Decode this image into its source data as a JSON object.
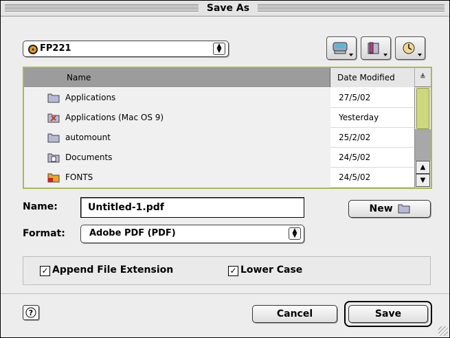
{
  "window": {
    "title": "Save As"
  },
  "location": {
    "selected": "FP221"
  },
  "toolbar": {
    "icons": [
      "shortcuts-icon",
      "favorites-icon",
      "recent-icon"
    ]
  },
  "filelist": {
    "columns": {
      "name": "Name",
      "date": "Date Modified",
      "sort": "≜"
    },
    "rows": [
      {
        "name": "Applications",
        "date": "27/5/02",
        "icon": "folder-icon"
      },
      {
        "name": "Applications (Mac OS 9)",
        "date": "Yesterday",
        "icon": "app-folder-icon"
      },
      {
        "name": "automount",
        "date": "25/2/02",
        "icon": "folder-icon"
      },
      {
        "name": "Documents",
        "date": "24/5/02",
        "icon": "documents-folder-icon"
      },
      {
        "name": "FONTS",
        "date": "24/5/02",
        "icon": "fonts-folder-icon"
      }
    ]
  },
  "name_field": {
    "label": "Name:",
    "value": "Untitled-1.pdf"
  },
  "new_button": {
    "label": "New"
  },
  "format": {
    "label": "Format:",
    "selected": "Adobe PDF (PDF)"
  },
  "options": {
    "append_extension": {
      "label": "Append File Extension",
      "checked": true
    },
    "lower_case": {
      "label": "Lower Case",
      "checked": true
    }
  },
  "buttons": {
    "help": "?",
    "cancel": "Cancel",
    "save": "Save"
  },
  "colors": {
    "accent": "#a8b855",
    "header_selected": "#9c9c9c"
  }
}
